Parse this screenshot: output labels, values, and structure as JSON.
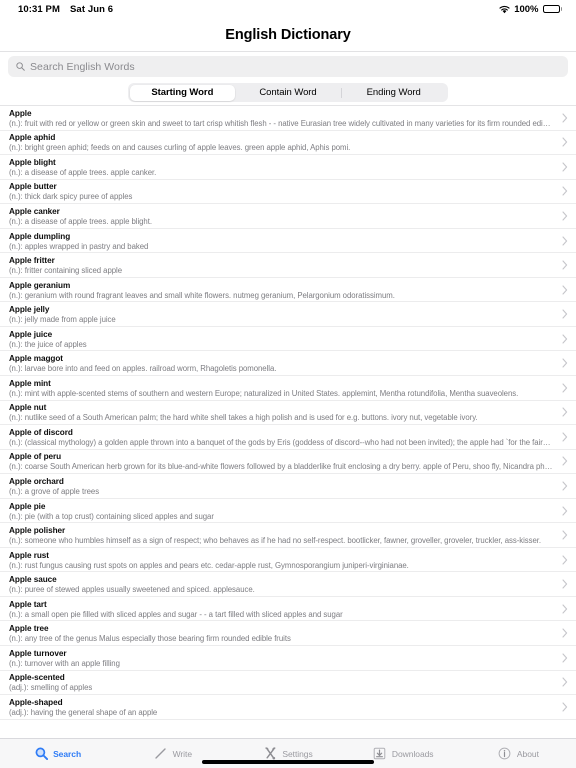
{
  "status_bar": {
    "time": "10:31 PM",
    "date": "Sat Jun 6",
    "wifi_icon": "wifi-icon",
    "battery_percent": "100%",
    "battery_icon": "battery-full-icon"
  },
  "header": {
    "title": "English Dictionary"
  },
  "search": {
    "icon": "search-icon",
    "placeholder": "Search English Words",
    "value": ""
  },
  "segmented_control": {
    "selected": "Starting Word",
    "options": [
      {
        "label": "Starting Word",
        "active": true
      },
      {
        "label": "Contain Word",
        "active": false
      },
      {
        "label": "Ending Word",
        "active": false
      }
    ]
  },
  "list": {
    "disclosure_icon": "chevron-right-icon",
    "entries": [
      {
        "word": "Apple",
        "definition": "(n.): fruit with red or yellow or green skin and sweet to tart crisp whitish flesh  -  - native Eurasian tree widely cultivated in many varieties for its firm rounded edible fruits...."
      },
      {
        "word": "Apple aphid",
        "definition": "(n.): bright green aphid; feeds on and causes curling of apple leaves.  green apple aphid, Aphis pomi."
      },
      {
        "word": "Apple blight",
        "definition": "(n.): a disease of apple trees.  apple canker."
      },
      {
        "word": "Apple butter",
        "definition": "(n.): thick dark spicy puree of apples"
      },
      {
        "word": "Apple canker",
        "definition": "(n.): a disease of apple trees.  apple blight."
      },
      {
        "word": "Apple dumpling",
        "definition": "(n.): apples wrapped in pastry and baked"
      },
      {
        "word": "Apple fritter",
        "definition": "(n.): fritter containing sliced apple"
      },
      {
        "word": "Apple geranium",
        "definition": "(n.): geranium with round fragrant leaves and small white flowers.  nutmeg geranium, Pelargonium odoratissimum."
      },
      {
        "word": "Apple jelly",
        "definition": "(n.): jelly made from apple juice"
      },
      {
        "word": "Apple juice",
        "definition": "(n.): the juice of apples"
      },
      {
        "word": "Apple maggot",
        "definition": "(n.): larvae bore into and feed on apples.  railroad worm, Rhagoletis pomonella."
      },
      {
        "word": "Apple mint",
        "definition": "(n.): mint with apple-scented stems of southern and western Europe; naturalized in United States.  applemint, Mentha rotundifolia, Mentha suaveolens."
      },
      {
        "word": "Apple nut",
        "definition": "(n.): nutlike seed of a South American palm; the hard white shell takes a high polish and is used for e.g. buttons.  ivory nut, vegetable ivory."
      },
      {
        "word": "Apple of discord",
        "definition": "(n.): (classical mythology) a golden apple thrown into a banquet of the gods by Eris (goddess of discord--who had not been invited); the apple had `for the fairest' written...."
      },
      {
        "word": "Apple of peru",
        "definition": "(n.): coarse South American herb grown for its blue-and-white flowers followed by a bladderlike fruit enclosing a dry berry.  apple of Peru, shoo fly, Nicandra physaloides...."
      },
      {
        "word": "Apple orchard",
        "definition": "(n.): a grove of apple trees"
      },
      {
        "word": "Apple pie",
        "definition": "(n.): pie (with a top crust) containing sliced apples and sugar"
      },
      {
        "word": "Apple polisher",
        "definition": "(n.): someone who humbles himself as a sign of respect; who behaves as if he had no self-respect.  bootlicker, fawner, groveller, groveler, truckler, ass-kisser."
      },
      {
        "word": "Apple rust",
        "definition": "(n.): rust fungus causing rust spots on apples and pears etc.  cedar-apple rust, Gymnosporangium juniperi-virginianae."
      },
      {
        "word": "Apple sauce",
        "definition": "(n.): puree of stewed apples usually sweetened and spiced.  applesauce."
      },
      {
        "word": "Apple tart",
        "definition": "(n.): a small open pie filled with sliced apples and sugar  -  - a tart filled with sliced apples and sugar"
      },
      {
        "word": "Apple tree",
        "definition": "(n.): any tree of the genus Malus especially those bearing firm rounded edible fruits"
      },
      {
        "word": "Apple turnover",
        "definition": "(n.): turnover with an apple filling"
      },
      {
        "word": "Apple-scented",
        "definition": "(adj.): smelling of apples"
      },
      {
        "word": "Apple-shaped",
        "definition": "(adj.): having the general shape of an apple"
      }
    ]
  },
  "tab_bar": {
    "tabs": [
      {
        "label": "Search",
        "icon": "search-icon",
        "active": true
      },
      {
        "label": "Write",
        "icon": "pencil-icon",
        "active": false
      },
      {
        "label": "Settings",
        "icon": "tools-icon",
        "active": false
      },
      {
        "label": "Downloads",
        "icon": "download-box-icon",
        "active": false
      },
      {
        "label": "About",
        "icon": "info-circle-icon",
        "active": false
      }
    ]
  },
  "colors": {
    "accent": "#2f7cf6",
    "tab_inactive": "#9a9aa0",
    "definition_text": "#7d7d82",
    "search_field_bg": "#efeff0",
    "tabbar_bg": "#f7f7f8"
  }
}
